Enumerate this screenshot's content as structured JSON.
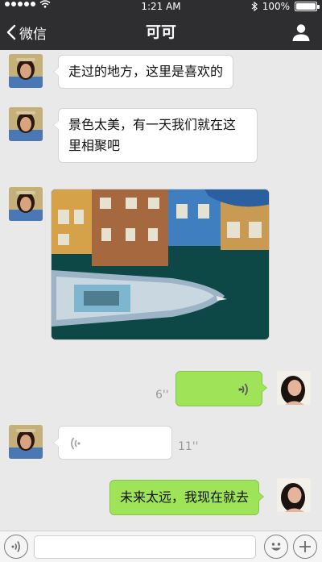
{
  "status_bar": {
    "time": "1:21 AM",
    "battery": "100%"
  },
  "nav": {
    "back_label": "微信",
    "title": "可可"
  },
  "messages": {
    "m1": {
      "text": "走过的地方，这里是喜欢的"
    },
    "m2": {
      "text": "景色太美，有一天我们就在这里相聚吧"
    },
    "m4": {
      "duration": "6''"
    },
    "m5": {
      "duration": "11''"
    },
    "m6": {
      "text": "未来太远，我现在就去"
    }
  },
  "input_bar": {
    "placeholder": ""
  },
  "colors": {
    "nav_bg": "#2e2e31",
    "chat_bg": "#e9e9e9",
    "out_bubble": "#9fe358",
    "in_bubble": "#ffffff"
  }
}
